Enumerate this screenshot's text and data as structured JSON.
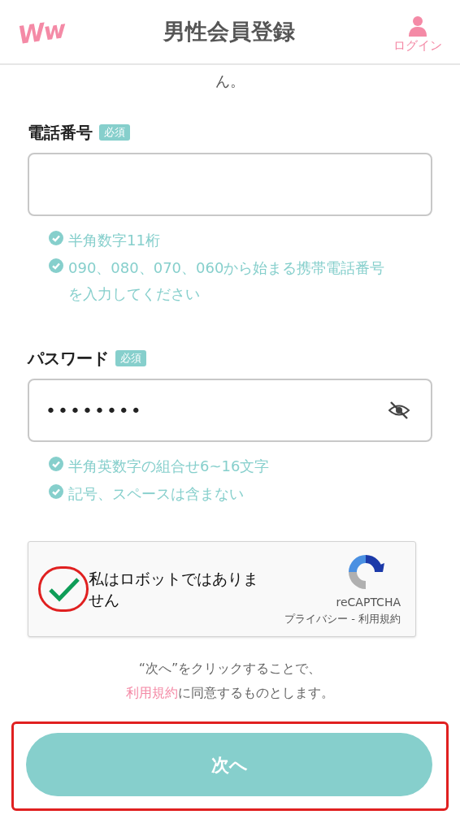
{
  "header": {
    "logo": "Ww",
    "title": "男性会員登録",
    "login": "ログイン"
  },
  "cut_text": "ん。",
  "fields": [
    {
      "kind": "tel",
      "label": "電話番号",
      "badge": "必須",
      "hints": [
        "半角数字11桁",
        "090、080、070、060から始まる携帯電話番号を入力してください"
      ]
    },
    {
      "kind": "password",
      "label": "パスワード",
      "badge": "必須",
      "value": "••••••••",
      "password_visible": false,
      "hints": [
        "半角英数字の組合せ6~16文字",
        "記号、スペースは含まない"
      ]
    }
  ],
  "captcha": {
    "label": "私はロボットではありません",
    "checked": true,
    "circled": true,
    "brand": "reCAPTCHA",
    "links": "プライバシー - 利用規約"
  },
  "consent": [
    "“次へ”をクリックすることで、",
    "**利用規約**に同意するものとします。"
  ],
  "submit": {
    "label": "次へ",
    "outlined": true
  }
}
